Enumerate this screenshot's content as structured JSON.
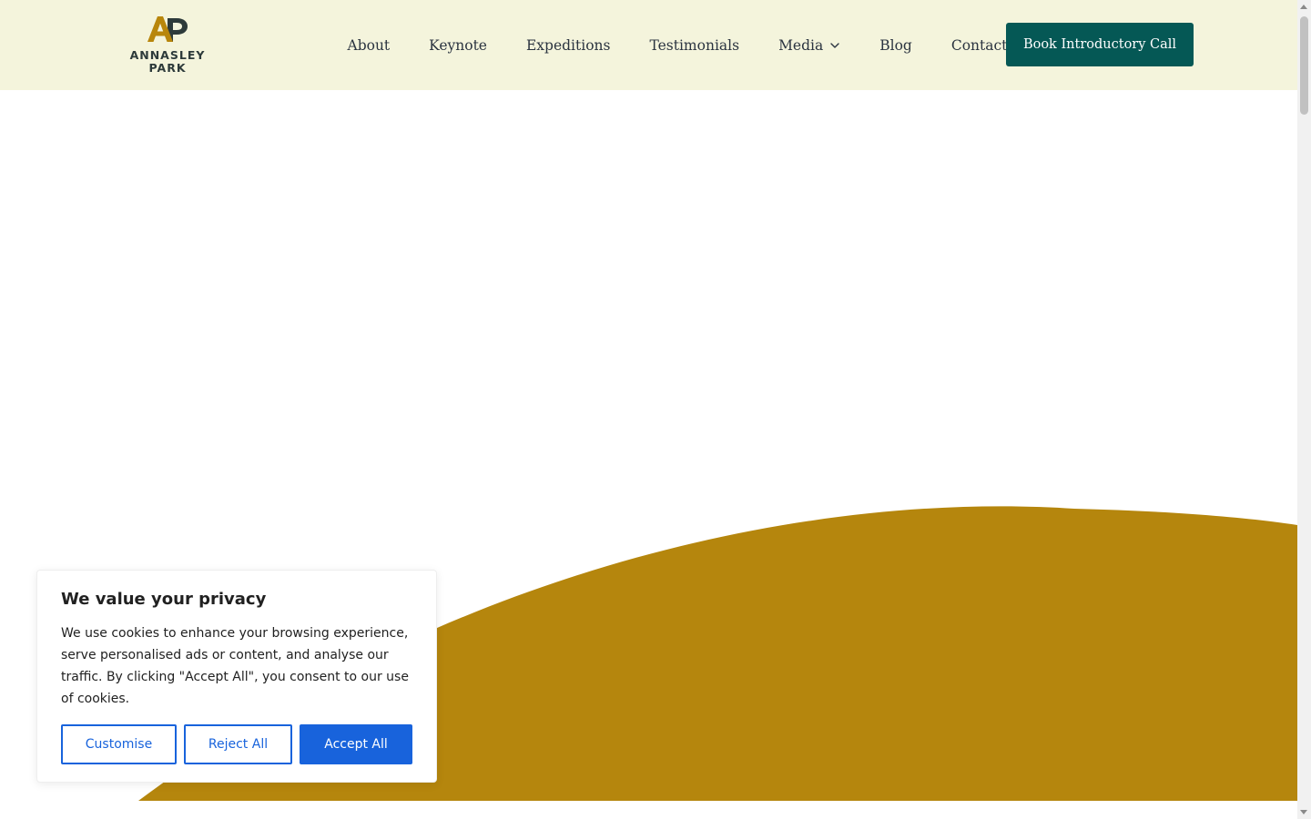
{
  "colors": {
    "header_background": "#f4f4dc",
    "cta_background": "#055855",
    "hero_shape": "#b5860d",
    "logo_gold": "#b8860b",
    "logo_dark": "#2d3a3a",
    "cookie_primary": "#1863dc"
  },
  "header": {
    "logo": {
      "icon": "annasley-park-logo-icon",
      "line1": "ANNASLEY",
      "line2": "PARK"
    },
    "nav": [
      {
        "label": "About"
      },
      {
        "label": "Keynote"
      },
      {
        "label": "Expeditions"
      },
      {
        "label": "Testimonials"
      },
      {
        "label": "Media",
        "icon": "chevron-down-icon"
      },
      {
        "label": "Blog"
      },
      {
        "label": "Contact"
      }
    ],
    "cta_label": "Book Introductory Call"
  },
  "cookie_banner": {
    "title": "We value your privacy",
    "text": "We use cookies to enhance your browsing experience, serve personalised ads or content, and analyse our traffic. By clicking \"Accept All\", you consent to our use of cookies.",
    "buttons": {
      "customise": "Customise",
      "reject": "Reject All",
      "accept": "Accept All"
    }
  }
}
